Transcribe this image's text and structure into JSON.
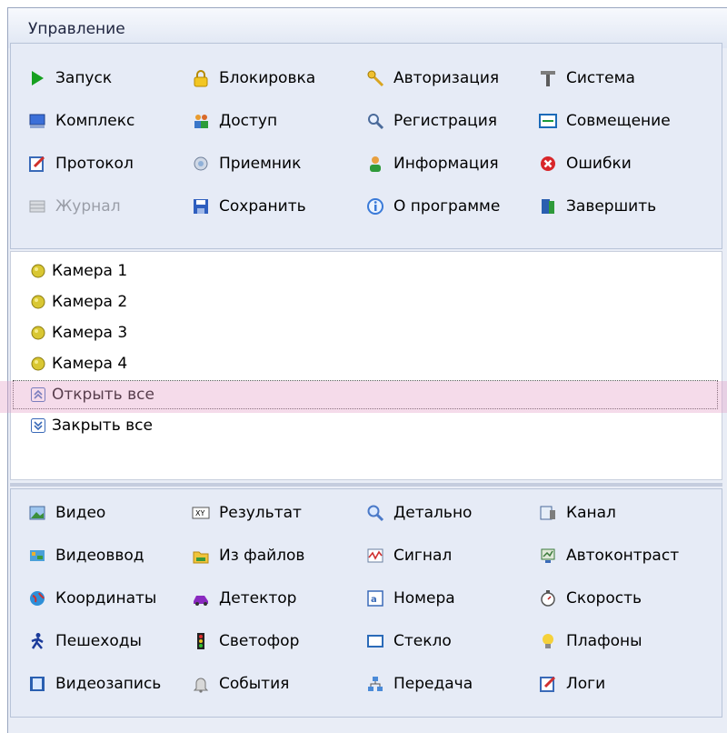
{
  "header": {
    "title": "Управление"
  },
  "control_panel": {
    "items": [
      {
        "label": "Запуск",
        "icon": "play-icon",
        "enabled": true
      },
      {
        "label": "Блокировка",
        "icon": "padlock-icon",
        "enabled": true
      },
      {
        "label": "Авторизация",
        "icon": "key-icon",
        "enabled": true
      },
      {
        "label": "Система",
        "icon": "tools-icon",
        "enabled": true
      },
      {
        "label": "Комплекс",
        "icon": "computer-icon",
        "enabled": true
      },
      {
        "label": "Доступ",
        "icon": "users-icon",
        "enabled": true
      },
      {
        "label": "Регистрация",
        "icon": "magnifier-key-icon",
        "enabled": true
      },
      {
        "label": "Совмещение",
        "icon": "align-window-icon",
        "enabled": true
      },
      {
        "label": "Протокол",
        "icon": "edit-document-icon",
        "enabled": true
      },
      {
        "label": "Приемник",
        "icon": "network-globe-icon",
        "enabled": true
      },
      {
        "label": "Информация",
        "icon": "user-info-icon",
        "enabled": true
      },
      {
        "label": "Ошибки",
        "icon": "error-icon",
        "enabled": true
      },
      {
        "label": "Журнал",
        "icon": "journal-icon",
        "enabled": false
      },
      {
        "label": "Сохранить",
        "icon": "save-disk-icon",
        "enabled": true
      },
      {
        "label": "О программе",
        "icon": "about-info-icon",
        "enabled": true
      },
      {
        "label": "Завершить",
        "icon": "exit-door-icon",
        "enabled": true
      }
    ]
  },
  "camera_list": {
    "items": [
      {
        "label": "Камера 1",
        "icon": "camera-status-icon"
      },
      {
        "label": "Камера 2",
        "icon": "camera-status-icon"
      },
      {
        "label": "Камера 3",
        "icon": "camera-status-icon"
      },
      {
        "label": "Камера 4",
        "icon": "camera-status-icon"
      },
      {
        "label": "Открыть все",
        "icon": "expand-all-icon"
      },
      {
        "label": "Закрыть все",
        "icon": "collapse-all-icon"
      }
    ]
  },
  "tool_panel": {
    "items": [
      {
        "label": "Видео",
        "icon": "video-image-icon"
      },
      {
        "label": "Результат",
        "icon": "result-xy-icon"
      },
      {
        "label": "Детально",
        "icon": "magnifier-icon"
      },
      {
        "label": "Канал",
        "icon": "channel-icon"
      },
      {
        "label": "Видеоввод",
        "icon": "video-input-icon"
      },
      {
        "label": "Из файлов",
        "icon": "folder-files-icon"
      },
      {
        "label": "Сигнал",
        "icon": "signal-wave-icon"
      },
      {
        "label": "Автоконтраст",
        "icon": "auto-contrast-icon"
      },
      {
        "label": "Координаты",
        "icon": "globe-coordinates-icon"
      },
      {
        "label": "Детектор",
        "icon": "car-detector-icon"
      },
      {
        "label": "Номера",
        "icon": "plate-numbers-icon"
      },
      {
        "label": "Скорость",
        "icon": "stopwatch-icon"
      },
      {
        "label": "Пешеходы",
        "icon": "pedestrian-icon"
      },
      {
        "label": "Светофор",
        "icon": "traffic-light-icon"
      },
      {
        "label": "Стекло",
        "icon": "glass-window-icon"
      },
      {
        "label": "Плафоны",
        "icon": "lightbulb-icon"
      },
      {
        "label": "Видеозапись",
        "icon": "film-record-icon"
      },
      {
        "label": "События",
        "icon": "bell-icon"
      },
      {
        "label": "Передача",
        "icon": "network-transfer-icon"
      },
      {
        "label": "Логи",
        "icon": "log-edit-icon"
      }
    ]
  },
  "colors": {
    "panel_bg": "#e6ebf6",
    "list_bg": "#ffffff",
    "highlight": "#e6a0c8",
    "disabled_text": "#9a9ea8"
  }
}
